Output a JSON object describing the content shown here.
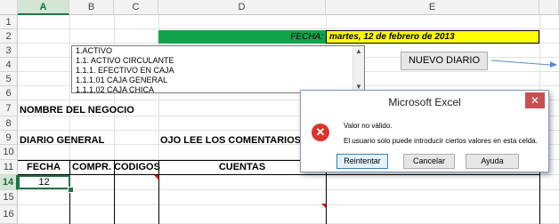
{
  "columns": [
    "A",
    "B",
    "C",
    "D",
    "E"
  ],
  "rows": [
    "1",
    "2",
    "3",
    "4",
    "5",
    "6",
    "7",
    "8",
    "9",
    "10",
    "11",
    "12",
    "13",
    "14",
    "15",
    "16"
  ],
  "fecha": {
    "label": "FECHA:",
    "value": "martes, 12 de febrero de 2013"
  },
  "listbox": {
    "items": [
      "1.ACTIVO",
      "1.1. ACTIVO CIRCULANTE",
      "1.1.1. EFECTIVO EN CAJA",
      "1.1.1.01 CAJA GENERAL",
      "1.1.1.02 CAJA CHICA"
    ],
    "scroll_up": "▲",
    "scroll_down": "▼"
  },
  "nuevo_diario": "NUEVO DIARIO",
  "nombre_negocio": "NOMBRE DEL NEGOCIO",
  "diario_general": "DIARIO GENERAL",
  "ojo": "OJO LEE LOS COMENTARIOS",
  "headers": {
    "fecha": "FECHA",
    "compr": "COMPR.",
    "codigos": "CODIGOS",
    "cuentas": "CUENTAS"
  },
  "a14": "12",
  "dialog": {
    "title": "Microsoft Excel",
    "close": "✕",
    "icon": "✕",
    "line1": "Valor no válido.",
    "line2": "El usuario solo puede introducir ciertos valores en esta celda.",
    "buttons": [
      "Reintentar",
      "Cancelar",
      "Ayuda"
    ]
  },
  "colors": {
    "green": "#0fa34a",
    "yellow": "#ffff00",
    "excel_green": "#217346"
  }
}
